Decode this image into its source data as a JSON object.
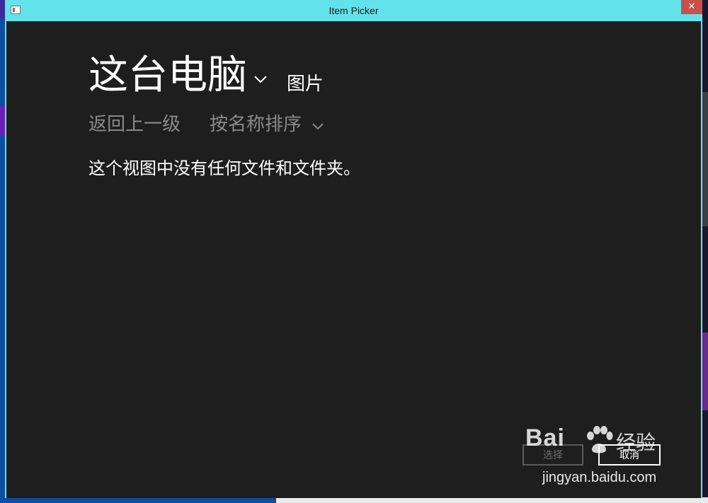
{
  "window": {
    "title": "Item Picker",
    "close_glyph": "✕"
  },
  "header": {
    "location": "这台电脑",
    "folder": "图片"
  },
  "toolbar": {
    "back_label": "返回上一级",
    "sort_label": "按名称排序"
  },
  "main": {
    "empty_message": "这个视图中没有任何文件和文件夹。"
  },
  "footer": {
    "select_label": "选择",
    "cancel_label": "取消"
  },
  "watermark": {
    "logo_text": "Bai",
    "logo_cn": "经验",
    "url": "jingyan.baidu.com"
  },
  "colors": {
    "titlebar": "#64e2ec",
    "content_bg": "#1e1e1e",
    "close_button": "#c7504a"
  },
  "icons": {
    "app": "app-window-icon",
    "location_dropdown": "chevron-down-icon",
    "sort_dropdown": "chevron-down-icon",
    "close": "close-icon"
  }
}
